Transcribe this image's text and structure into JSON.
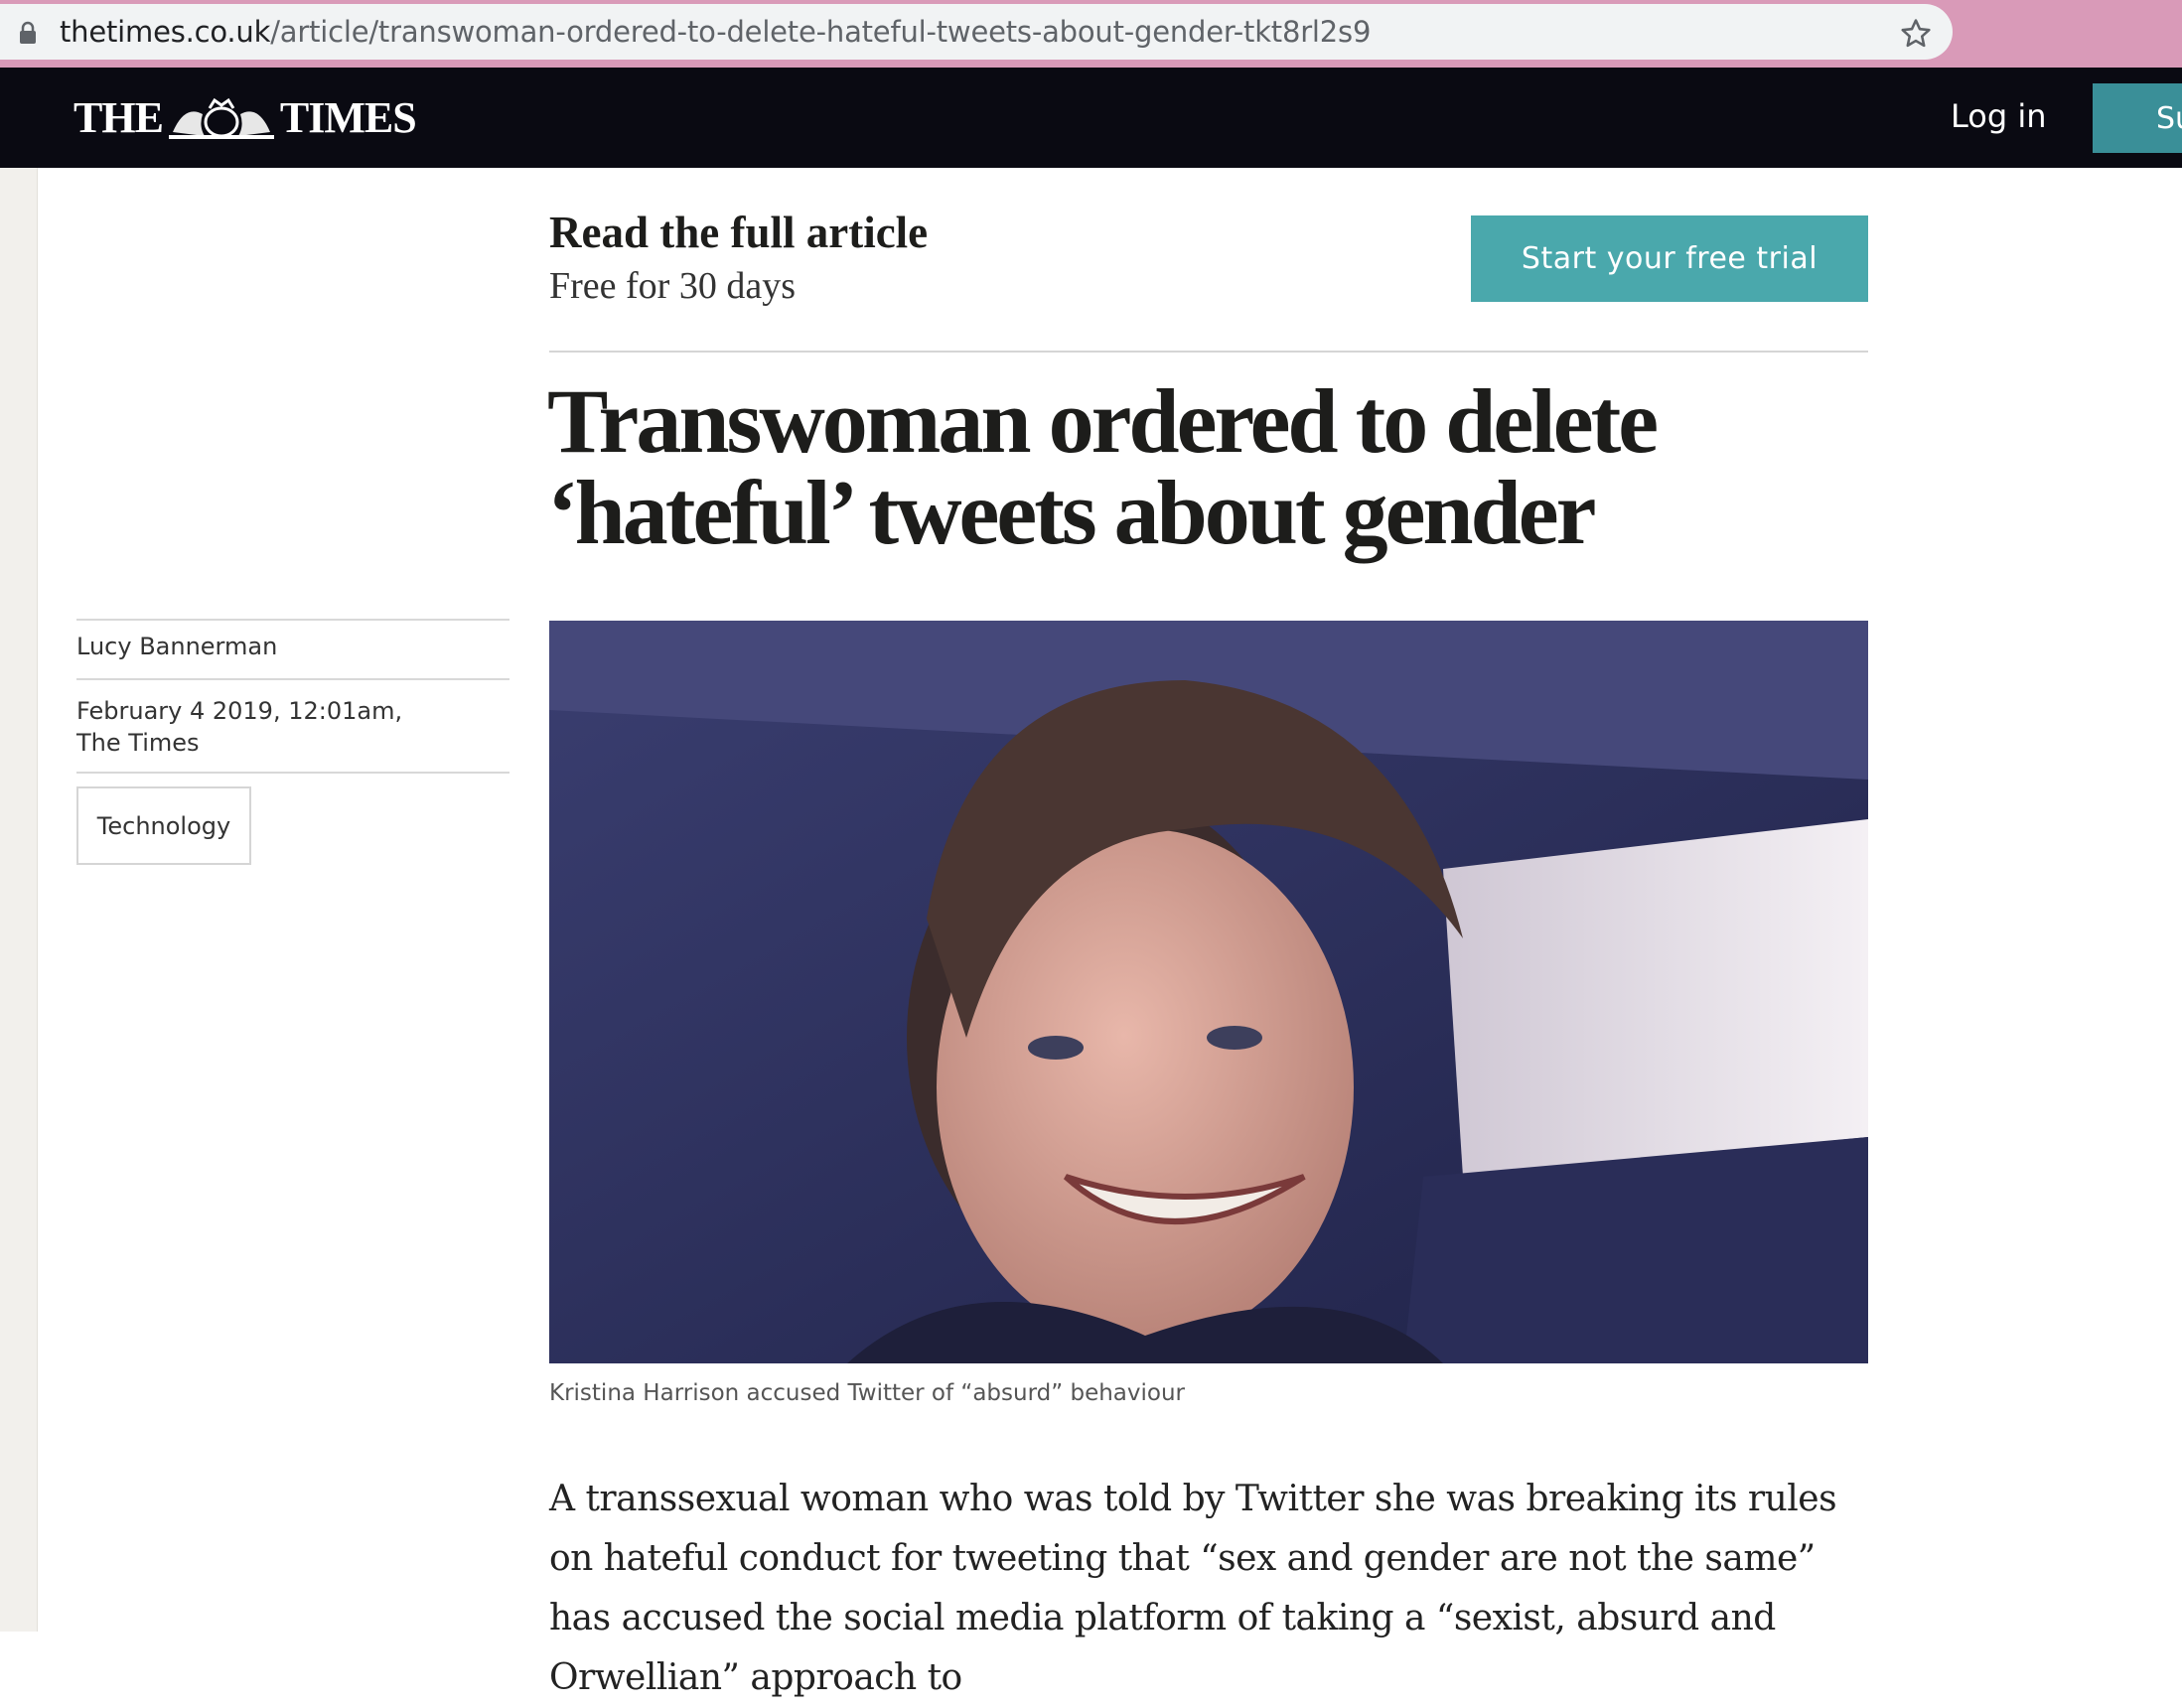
{
  "browser": {
    "url_domain": "thetimes.co.uk",
    "url_path": "/article/transwoman-ordered-to-delete-hateful-tweets-about-gender-tkt8rl2s9"
  },
  "header": {
    "logo_left": "THE",
    "logo_right": "TIMES",
    "login_label": "Log in",
    "subscribe_label": "Su"
  },
  "promo": {
    "title": "Read the full article",
    "subtitle": "Free for 30 days",
    "trial_label": "Start your free trial"
  },
  "article": {
    "headline": "Transwoman ordered to delete ‘hateful’ tweets about gender",
    "author": "Lucy Bannerman",
    "date": "February 4 2019, 12:01am,",
    "publication": "The Times",
    "tag": "Technology",
    "caption": "Kristina Harrison accused Twitter of “absurd” behaviour",
    "body": "A transsexual woman who was told by Twitter she was breaking its rules on hateful conduct for tweeting that “sex and gender are not the same” has accused the social media platform of taking a “sexist, absurd and Orwellian” approach to"
  },
  "colors": {
    "browser_frame": "#d99ab8",
    "header_bg": "#0a0a12",
    "trial_button": "#4aa8ac",
    "subscribe_button": "#3a8f98"
  },
  "icons": [
    "lock-icon",
    "star-icon",
    "times-crest-icon"
  ]
}
